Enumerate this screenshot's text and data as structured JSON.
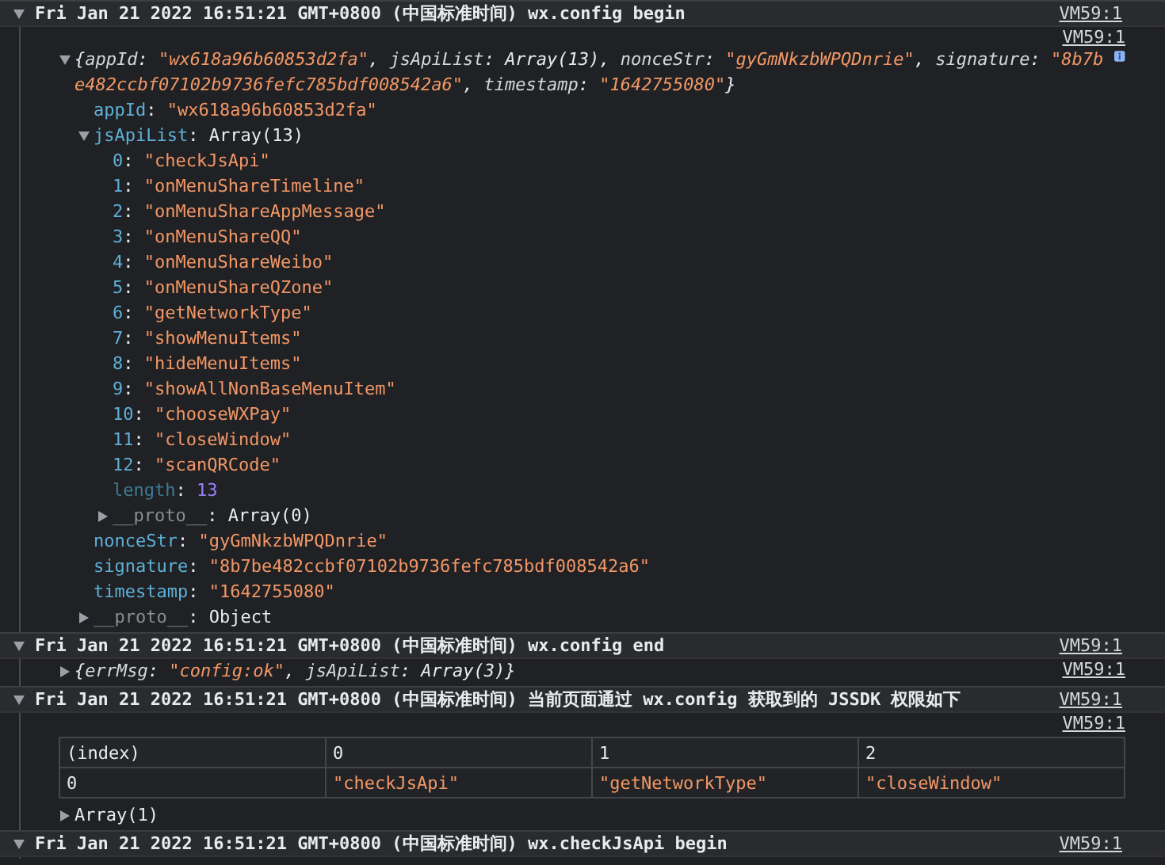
{
  "groups": [
    {
      "title": "Fri Jan 21 2022 16:51:21 GMT+0800 (中国标准时间) wx.config begin",
      "source": "VM59:1",
      "expanded": true,
      "entries": [
        {
          "kind": "tree",
          "source": "VM59:1",
          "expanded": true,
          "italic": true,
          "info": true,
          "summary": [
            {
              "text": "{",
              "kind": "punct"
            },
            {
              "text": "appId",
              "kind": "key"
            },
            {
              "text": ": ",
              "kind": "punct"
            },
            {
              "text": "\"wx618a96b60853d2fa\"",
              "kind": "string"
            },
            {
              "text": ", ",
              "kind": "punct"
            },
            {
              "text": "jsApiList",
              "kind": "key"
            },
            {
              "text": ": ",
              "kind": "punct"
            },
            {
              "text": "Array(13)",
              "kind": "object"
            },
            {
              "text": ", ",
              "kind": "punct"
            },
            {
              "text": "nonceStr",
              "kind": "key"
            },
            {
              "text": ": ",
              "kind": "punct"
            },
            {
              "text": "\"gyGmNkzbWPQDnrie\"",
              "kind": "string"
            },
            {
              "text": ", ",
              "kind": "punct"
            },
            {
              "text": "signature",
              "kind": "key"
            },
            {
              "text": ": ",
              "kind": "punct"
            },
            {
              "text": "\"8b7be482ccbf07102b9736fefc785bdf008542a6\"",
              "kind": "string"
            },
            {
              "text": ", ",
              "kind": "punct"
            },
            {
              "text": "timestamp",
              "kind": "key"
            },
            {
              "text": ": ",
              "kind": "punct"
            },
            {
              "text": "\"1642755080\"",
              "kind": "string"
            },
            {
              "text": "}",
              "kind": "punct"
            }
          ],
          "children": [
            {
              "key": "appId",
              "sep": ": ",
              "value": "\"wx618a96b60853d2fa\"",
              "kind": "string",
              "dim": false
            },
            {
              "key": "jsApiList",
              "sep": ": ",
              "value": "Array(13)",
              "kind": "object",
              "dim": false,
              "expanded": true,
              "children": [
                {
                  "key": "0",
                  "sep": ": ",
                  "value": "\"checkJsApi\"",
                  "kind": "string",
                  "dim": false
                },
                {
                  "key": "1",
                  "sep": ": ",
                  "value": "\"onMenuShareTimeline\"",
                  "kind": "string",
                  "dim": false
                },
                {
                  "key": "2",
                  "sep": ": ",
                  "value": "\"onMenuShareAppMessage\"",
                  "kind": "string",
                  "dim": false
                },
                {
                  "key": "3",
                  "sep": ": ",
                  "value": "\"onMenuShareQQ\"",
                  "kind": "string",
                  "dim": false
                },
                {
                  "key": "4",
                  "sep": ": ",
                  "value": "\"onMenuShareWeibo\"",
                  "kind": "string",
                  "dim": false
                },
                {
                  "key": "5",
                  "sep": ": ",
                  "value": "\"onMenuShareQZone\"",
                  "kind": "string",
                  "dim": false
                },
                {
                  "key": "6",
                  "sep": ": ",
                  "value": "\"getNetworkType\"",
                  "kind": "string",
                  "dim": false
                },
                {
                  "key": "7",
                  "sep": ": ",
                  "value": "\"showMenuItems\"",
                  "kind": "string",
                  "dim": false
                },
                {
                  "key": "8",
                  "sep": ": ",
                  "value": "\"hideMenuItems\"",
                  "kind": "string",
                  "dim": false
                },
                {
                  "key": "9",
                  "sep": ": ",
                  "value": "\"showAllNonBaseMenuItem\"",
                  "kind": "string",
                  "dim": false
                },
                {
                  "key": "10",
                  "sep": ": ",
                  "value": "\"chooseWXPay\"",
                  "kind": "string",
                  "dim": false
                },
                {
                  "key": "11",
                  "sep": ": ",
                  "value": "\"closeWindow\"",
                  "kind": "string",
                  "dim": false
                },
                {
                  "key": "12",
                  "sep": ": ",
                  "value": "\"scanQRCode\"",
                  "kind": "string",
                  "dim": false
                },
                {
                  "key": "length",
                  "sep": ": ",
                  "value": "13",
                  "kind": "number",
                  "dim": true
                },
                {
                  "key": "__proto__",
                  "sep": ": ",
                  "value": "Array(0)",
                  "kind": "object",
                  "dim": true,
                  "expanded": false
                }
              ]
            },
            {
              "key": "nonceStr",
              "sep": ": ",
              "value": "\"gyGmNkzbWPQDnrie\"",
              "kind": "string",
              "dim": false
            },
            {
              "key": "signature",
              "sep": ": ",
              "value": "\"8b7be482ccbf07102b9736fefc785bdf008542a6\"",
              "kind": "string",
              "dim": false
            },
            {
              "key": "timestamp",
              "sep": ": ",
              "value": "\"1642755080\"",
              "kind": "string",
              "dim": false
            },
            {
              "key": "__proto__",
              "sep": ": ",
              "value": "Object",
              "kind": "object",
              "dim": true,
              "expanded": false
            }
          ]
        }
      ]
    },
    {
      "title": "Fri Jan 21 2022 16:51:21 GMT+0800 (中国标准时间) wx.config end",
      "source": "VM59:1",
      "expanded": true,
      "entries": [
        {
          "kind": "tree",
          "source": "VM59:1",
          "expanded": false,
          "italic": true,
          "info": false,
          "summary": [
            {
              "text": "{",
              "kind": "punct"
            },
            {
              "text": "errMsg",
              "kind": "key"
            },
            {
              "text": ": ",
              "kind": "punct"
            },
            {
              "text": "\"config:ok\"",
              "kind": "string"
            },
            {
              "text": ", ",
              "kind": "punct"
            },
            {
              "text": "jsApiList",
              "kind": "key"
            },
            {
              "text": ": ",
              "kind": "punct"
            },
            {
              "text": "Array(3)",
              "kind": "object"
            },
            {
              "text": "}",
              "kind": "punct"
            }
          ]
        }
      ]
    },
    {
      "title": "Fri Jan 21 2022 16:51:21 GMT+0800 (中国标准时间) 当前页面通过 wx.config 获取到的 JSSDK 权限如下",
      "source": "VM59:1",
      "expanded": true,
      "entries": [
        {
          "kind": "table",
          "source": "VM59:1",
          "columns": [
            "(index)",
            "0",
            "1",
            "2"
          ],
          "rows": [
            [
              {
                "text": "0",
                "kind": "plain"
              },
              {
                "text": "\"checkJsApi\"",
                "kind": "string"
              },
              {
                "text": "\"getNetworkType\"",
                "kind": "string"
              },
              {
                "text": "\"closeWindow\"",
                "kind": "string"
              }
            ]
          ]
        },
        {
          "kind": "tree",
          "expanded": false,
          "italic": false,
          "info": false,
          "summary": [
            {
              "text": "Array(1)",
              "kind": "object"
            }
          ]
        }
      ]
    },
    {
      "title": "Fri Jan 21 2022 16:51:21 GMT+0800 (中国标准时间) wx.checkJsApi begin",
      "source": "VM59:1",
      "expanded": true
    }
  ]
}
